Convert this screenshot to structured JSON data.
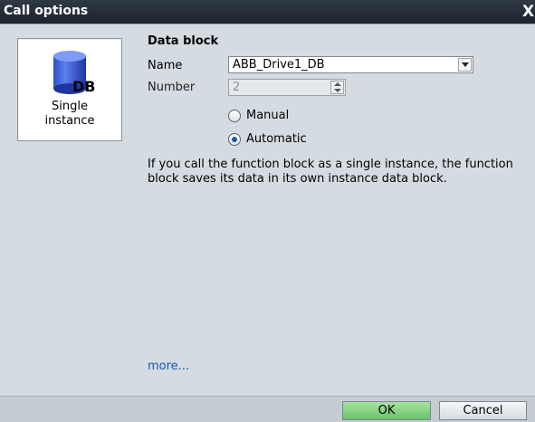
{
  "window": {
    "title": "Call options",
    "close_glyph": "X"
  },
  "left_panel": {
    "option_label": "Single\ninstance",
    "icon_text": "DB",
    "icon": "database-cylinder-icon"
  },
  "data_block": {
    "section_title": "Data block",
    "name_label": "Name",
    "name_value": "ABB_Drive1_DB",
    "number_label": "Number",
    "number_value": "2",
    "radio_manual": "Manual",
    "radio_automatic": "Automatic",
    "selected_mode": "Automatic",
    "description": "If you call the function block as a single instance, the function block saves its data in its own instance data block.",
    "more_link": "more..."
  },
  "footer": {
    "ok_label": "OK",
    "cancel_label": "Cancel"
  },
  "colors": {
    "accent": "#1a5bb8",
    "ok_button": "#6ac26a",
    "title_bar": "#1b232c"
  }
}
